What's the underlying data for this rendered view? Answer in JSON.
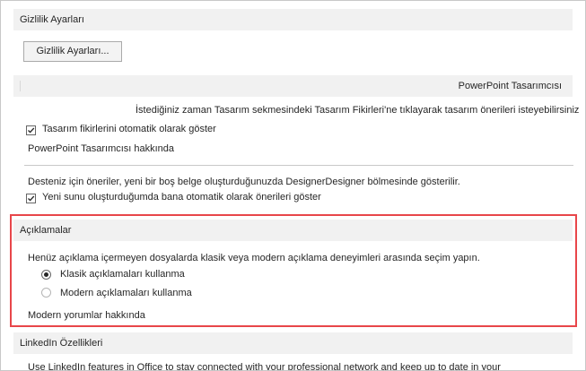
{
  "privacy": {
    "header": "Gizlilik Ayarları",
    "button_label": "Gizlilik Ayarları..."
  },
  "designer": {
    "header_label": "PowerPoint Tasarımcısı",
    "description": "İstediğiniz zaman Tasarım sekmesindeki Tasarım Fikirleri'ne tıklayarak tasarım önerileri isteyebilirsiniz",
    "checkbox1_label": "Tasarım fikirlerini otomatik olarak göster",
    "about_link": "PowerPoint Tasarımcısı hakkında",
    "new_deck_text": "Desteniz için öneriler, yeni bir boş belge oluşturduğunuzda DesignerDesigner bölmesinde gösterilir.",
    "checkbox2_label": "Yeni sunu oluşturduğumda bana otomatik olarak önerileri göster"
  },
  "comments": {
    "header": "Açıklamalar",
    "description": "Henüz açıklama içermeyen dosyalarda klasik veya modern açıklama deneyimleri arasında seçim yapın.",
    "option_classic": "Klasik açıklamaları kullanma",
    "option_modern": "Modern açıklamaları kullanma",
    "selected": "classic",
    "about_link": "Modern yorumlar hakkında"
  },
  "linkedin": {
    "header": "LinkedIn Özellikleri",
    "description": "Use LinkedIn features in Office to stay connected with your professional network and keep up to date in your"
  },
  "colors": {
    "highlight": "#e8464a",
    "header_bg": "#f1f1f1"
  }
}
